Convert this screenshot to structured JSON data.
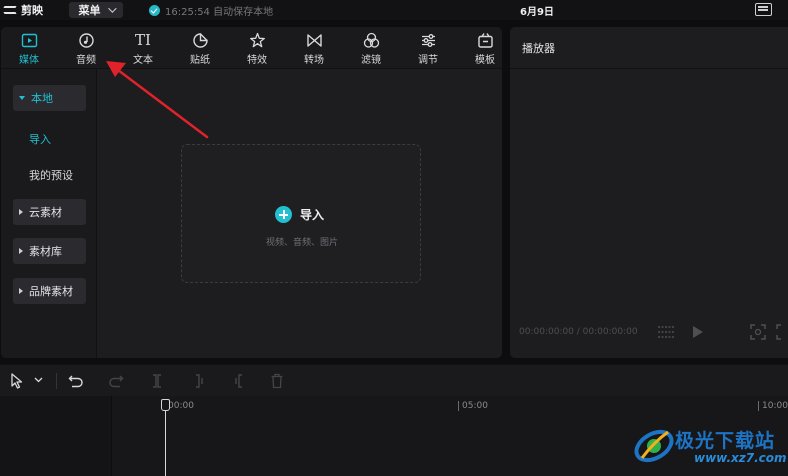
{
  "app": {
    "name": "剪映",
    "menu_label": "菜单",
    "save_status": "16:25:54 自动保存本地",
    "date": "6月9日"
  },
  "toolbar": {
    "tabs": [
      {
        "label": "媒体",
        "icon": "media-icon",
        "active": true
      },
      {
        "label": "音频",
        "icon": "audio-icon"
      },
      {
        "label": "文本",
        "icon": "text-icon"
      },
      {
        "label": "贴纸",
        "icon": "sticker-icon"
      },
      {
        "label": "特效",
        "icon": "effects-icon"
      },
      {
        "label": "转场",
        "icon": "transition-icon"
      },
      {
        "label": "滤镜",
        "icon": "filter-icon"
      },
      {
        "label": "调节",
        "icon": "adjust-icon"
      },
      {
        "label": "模板",
        "icon": "template-icon"
      }
    ],
    "text_icon_glyph": "TI"
  },
  "sidebar": {
    "local": "本地",
    "import": "导入",
    "my_presets": "我的预设",
    "cloud": "云素材",
    "library": "素材库",
    "brand": "品牌素材"
  },
  "dropzone": {
    "label": "导入",
    "hint": "视频、音频、图片"
  },
  "player": {
    "title": "播放器",
    "timecode": "00:00:00:00 / 00:00:00:00"
  },
  "timeline": {
    "ticks": [
      "00:00",
      "05:00",
      "10:00"
    ]
  },
  "watermark": {
    "text": "极光下载站",
    "url": "www.xz7.com"
  },
  "colors": {
    "accent": "#20c0d0",
    "annotation": "#e0222a",
    "background": "#0d0d0f",
    "panel": "#1d1d20"
  }
}
